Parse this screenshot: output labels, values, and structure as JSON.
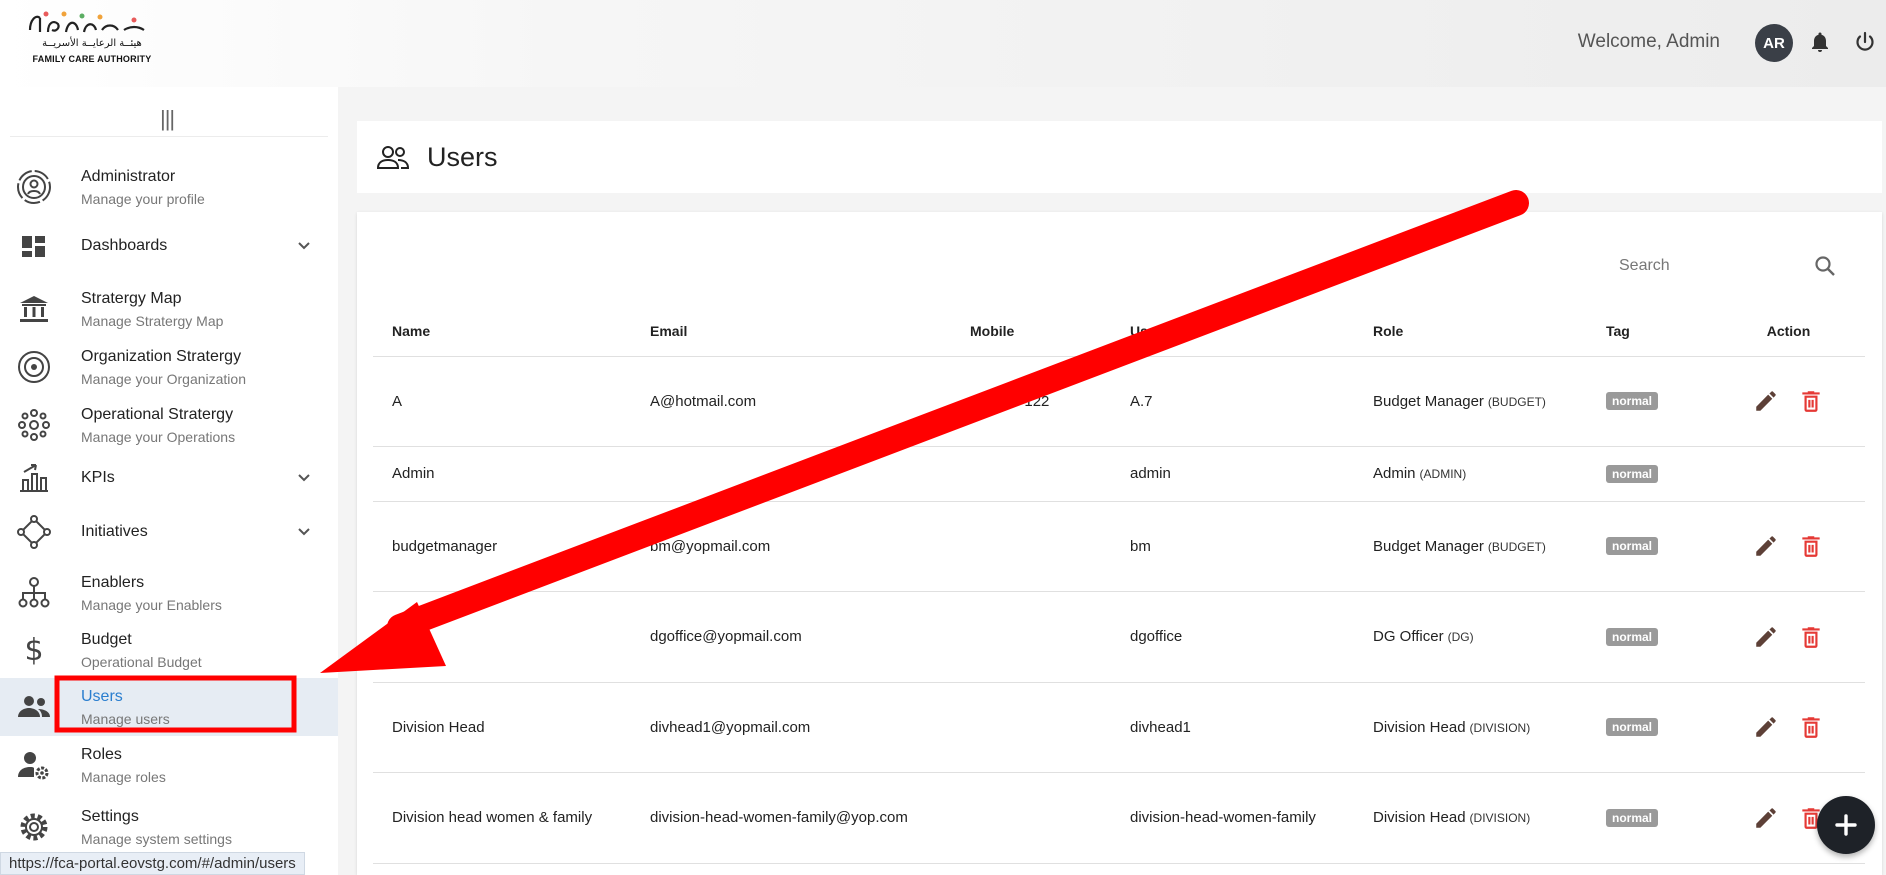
{
  "header": {
    "logo_ar": "هيئــة الرعايــة الأسريــة",
    "logo_en": "FAMILY CARE AUTHORITY",
    "welcome": "Welcome,  Admin",
    "avatar_initials": "AR"
  },
  "sidebar": {
    "items": [
      {
        "title": "Administrator",
        "subtitle": "Manage your profile",
        "icon": "profile-icon"
      },
      {
        "title": "Dashboards",
        "subtitle": "",
        "icon": "dashboard-icon",
        "expandable": true
      },
      {
        "title": "Stratergy Map",
        "subtitle": "Manage Stratergy Map",
        "icon": "bank-icon"
      },
      {
        "title": "Organization Stratergy",
        "subtitle": "Manage your Organization",
        "icon": "target-icon"
      },
      {
        "title": "Operational Stratergy",
        "subtitle": "Manage your Operations",
        "icon": "network-icon"
      },
      {
        "title": "KPIs",
        "subtitle": "",
        "icon": "kpi-chart-icon",
        "expandable": true
      },
      {
        "title": "Initiatives",
        "subtitle": "",
        "icon": "initiatives-icon",
        "expandable": true
      },
      {
        "title": "Enablers",
        "subtitle": "Manage your Enablers",
        "icon": "hierarchy-icon"
      },
      {
        "title": "Budget",
        "subtitle": "Operational Budget",
        "icon": "dollar-icon"
      },
      {
        "title": "Users",
        "subtitle": "Manage users",
        "icon": "users-icon",
        "active": true
      },
      {
        "title": "Roles",
        "subtitle": "Manage roles",
        "icon": "user-gear-icon"
      },
      {
        "title": "Settings",
        "subtitle": "Manage system settings",
        "icon": "settings-icon"
      }
    ]
  },
  "page": {
    "title": "Users",
    "search_placeholder": "Search"
  },
  "table": {
    "columns": [
      "Name",
      "Email",
      "Mobile",
      "Username",
      "Role",
      "Tag",
      "Action"
    ],
    "rows": [
      {
        "name": "A",
        "email": "A@hotmail.com",
        "mobile": "0507••••122",
        "username": "A.7",
        "role": "Budget Manager",
        "role_code": "(BUDGET)",
        "tag": "normal",
        "actions": true
      },
      {
        "name": "Admin",
        "email": "",
        "mobile": "",
        "username": "admin",
        "role": "Admin",
        "role_code": "(ADMIN)",
        "tag": "normal",
        "actions": false
      },
      {
        "name": "budgetmanager",
        "email": "bm@yopmail.com",
        "mobile": "",
        "username": "bm",
        "role": "Budget Manager",
        "role_code": "(BUDGET)",
        "tag": "normal",
        "actions": true
      },
      {
        "name": "",
        "email": "dgoffice@yopmail.com",
        "mobile": "",
        "username": "dgoffice",
        "role": "DG Officer",
        "role_code": "(DG)",
        "tag": "normal",
        "actions": true
      },
      {
        "name": "Division Head",
        "email": "divhead1@yopmail.com",
        "mobile": "",
        "username": "divhead1",
        "role": "Division Head",
        "role_code": "(DIVISION)",
        "tag": "normal",
        "actions": true
      },
      {
        "name": "Division head women & family",
        "email": "division-head-women-family@yop.com",
        "mobile": "",
        "username": "division-head-women-family",
        "role": "Division Head",
        "role_code": "(DIVISION)",
        "tag": "normal",
        "actions": true
      }
    ]
  },
  "status_bar": {
    "url": "https://fca-portal.eovstg.com/#/admin/users"
  },
  "colors": {
    "accent_blue": "#2a7ecf",
    "delete_red": "#e53935",
    "edit_brown": "#5d4037",
    "annotation_red": "#ff0000",
    "tag_gray": "#9a9a9a"
  }
}
